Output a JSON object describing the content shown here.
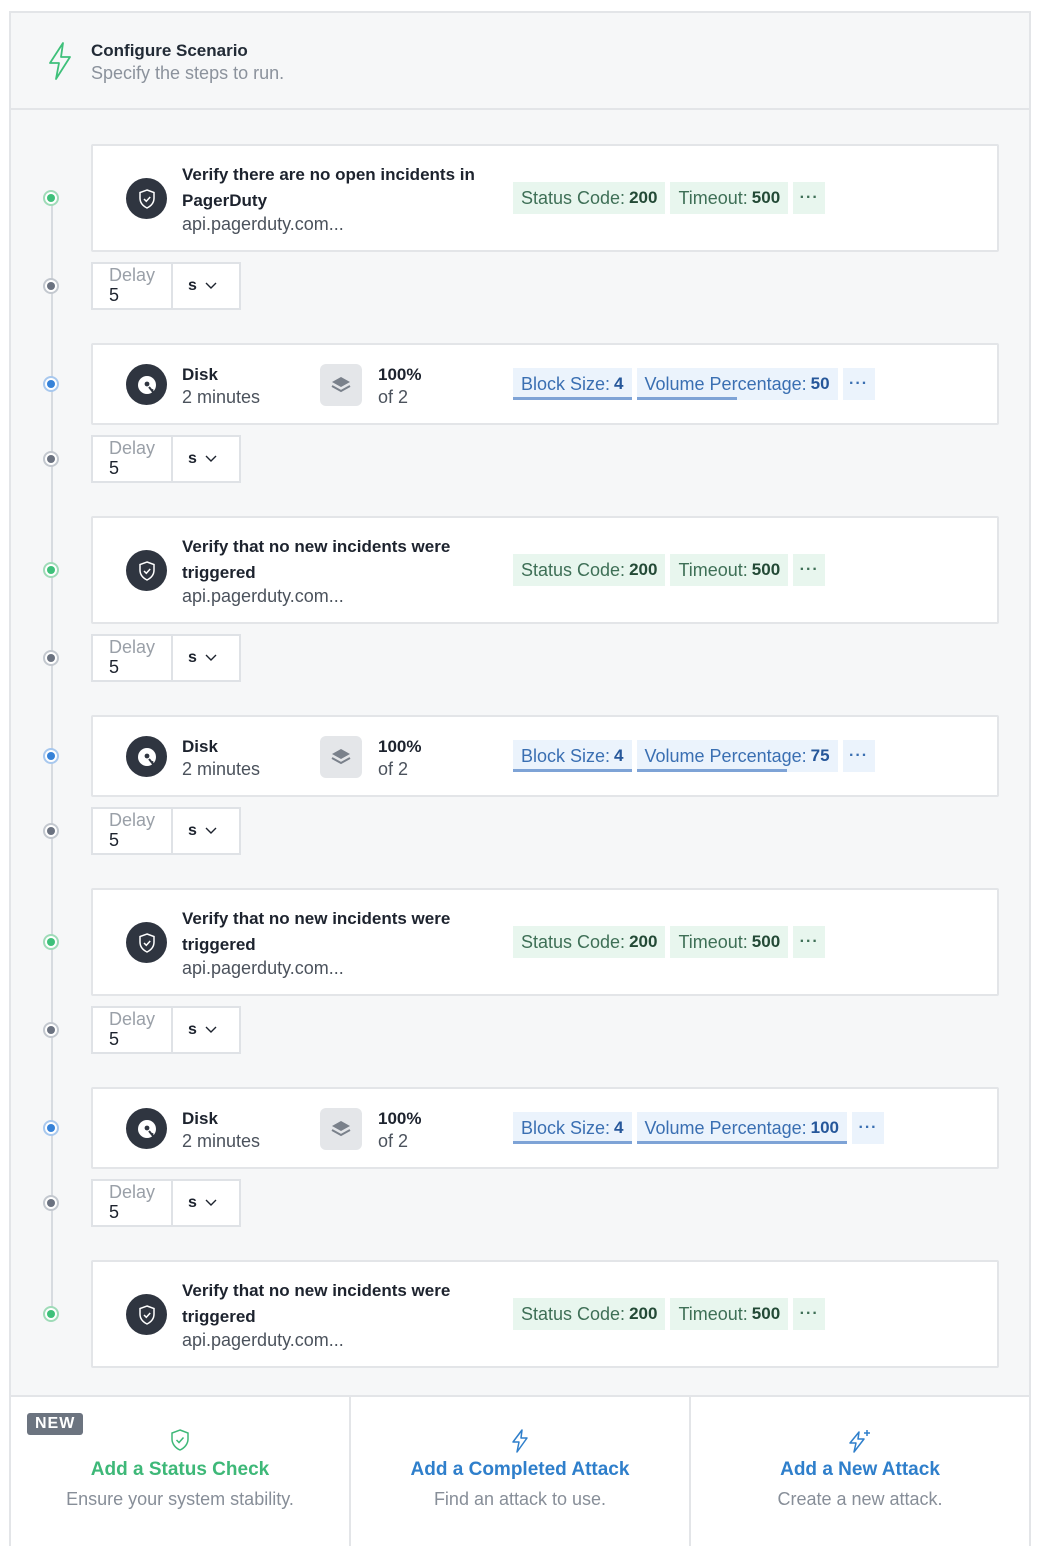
{
  "header": {
    "title": "Configure Scenario",
    "subtitle": "Specify the steps to run."
  },
  "steps": [
    {
      "type": "status_check",
      "title": "Verify there are no open incidents in PagerDuty",
      "subtitle": "api.pagerduty.com...",
      "chips": [
        {
          "label": "Status Code:",
          "value": "200"
        },
        {
          "label": "Timeout:",
          "value": "500"
        }
      ],
      "more": "···"
    },
    {
      "type": "delay",
      "label": "Delay",
      "value": "5",
      "unit": "s"
    },
    {
      "type": "attack",
      "title": "Disk",
      "subtitle": "2 minutes",
      "percent": "100%",
      "percent_sub": "of 2",
      "chips": [
        {
          "label": "Block Size:",
          "value": "4",
          "fill": 1.0
        },
        {
          "label": "Volume Percentage:",
          "value": "50",
          "fill": 0.5
        }
      ],
      "more": "···"
    },
    {
      "type": "delay",
      "label": "Delay",
      "value": "5",
      "unit": "s"
    },
    {
      "type": "status_check",
      "title": "Verify that no new incidents were triggered",
      "subtitle": "api.pagerduty.com...",
      "chips": [
        {
          "label": "Status Code:",
          "value": "200"
        },
        {
          "label": "Timeout:",
          "value": "500"
        }
      ],
      "more": "···"
    },
    {
      "type": "delay",
      "label": "Delay",
      "value": "5",
      "unit": "s"
    },
    {
      "type": "attack",
      "title": "Disk",
      "subtitle": "2 minutes",
      "percent": "100%",
      "percent_sub": "of 2",
      "chips": [
        {
          "label": "Block Size:",
          "value": "4",
          "fill": 1.0
        },
        {
          "label": "Volume Percentage:",
          "value": "75",
          "fill": 0.75
        }
      ],
      "more": "···"
    },
    {
      "type": "delay",
      "label": "Delay",
      "value": "5",
      "unit": "s"
    },
    {
      "type": "status_check",
      "title": "Verify that no new incidents were triggered",
      "subtitle": "api.pagerduty.com...",
      "chips": [
        {
          "label": "Status Code:",
          "value": "200"
        },
        {
          "label": "Timeout:",
          "value": "500"
        }
      ],
      "more": "···"
    },
    {
      "type": "delay",
      "label": "Delay",
      "value": "5",
      "unit": "s"
    },
    {
      "type": "attack",
      "title": "Disk",
      "subtitle": "2 minutes",
      "percent": "100%",
      "percent_sub": "of 2",
      "chips": [
        {
          "label": "Block Size:",
          "value": "4",
          "fill": 1.0
        },
        {
          "label": "Volume Percentage:",
          "value": "100",
          "fill": 1.0
        }
      ],
      "more": "···"
    },
    {
      "type": "delay",
      "label": "Delay",
      "value": "5",
      "unit": "s"
    },
    {
      "type": "status_check",
      "title": "Verify that no new incidents were triggered",
      "subtitle": "api.pagerduty.com...",
      "chips": [
        {
          "label": "Status Code:",
          "value": "200"
        },
        {
          "label": "Timeout:",
          "value": "500"
        }
      ],
      "more": "···"
    }
  ],
  "footer": {
    "new_tag": "NEW",
    "actions": [
      {
        "title": "Add a Status Check",
        "subtitle": "Ensure your system stability.",
        "color": "#3eb878",
        "icon": "shield-check-icon"
      },
      {
        "title": "Add a Completed Attack",
        "subtitle": "Find an attack to use.",
        "color": "#2f7fcb",
        "icon": "bolt-icon"
      },
      {
        "title": "Add a New Attack",
        "subtitle": "Create a new attack.",
        "color": "#2f7fcb",
        "icon": "bolt-plus-icon"
      }
    ]
  },
  "colors": {
    "status_green": "#3ec07a",
    "attack_blue": "#3682d8",
    "delay_gray": "#6b7280"
  }
}
